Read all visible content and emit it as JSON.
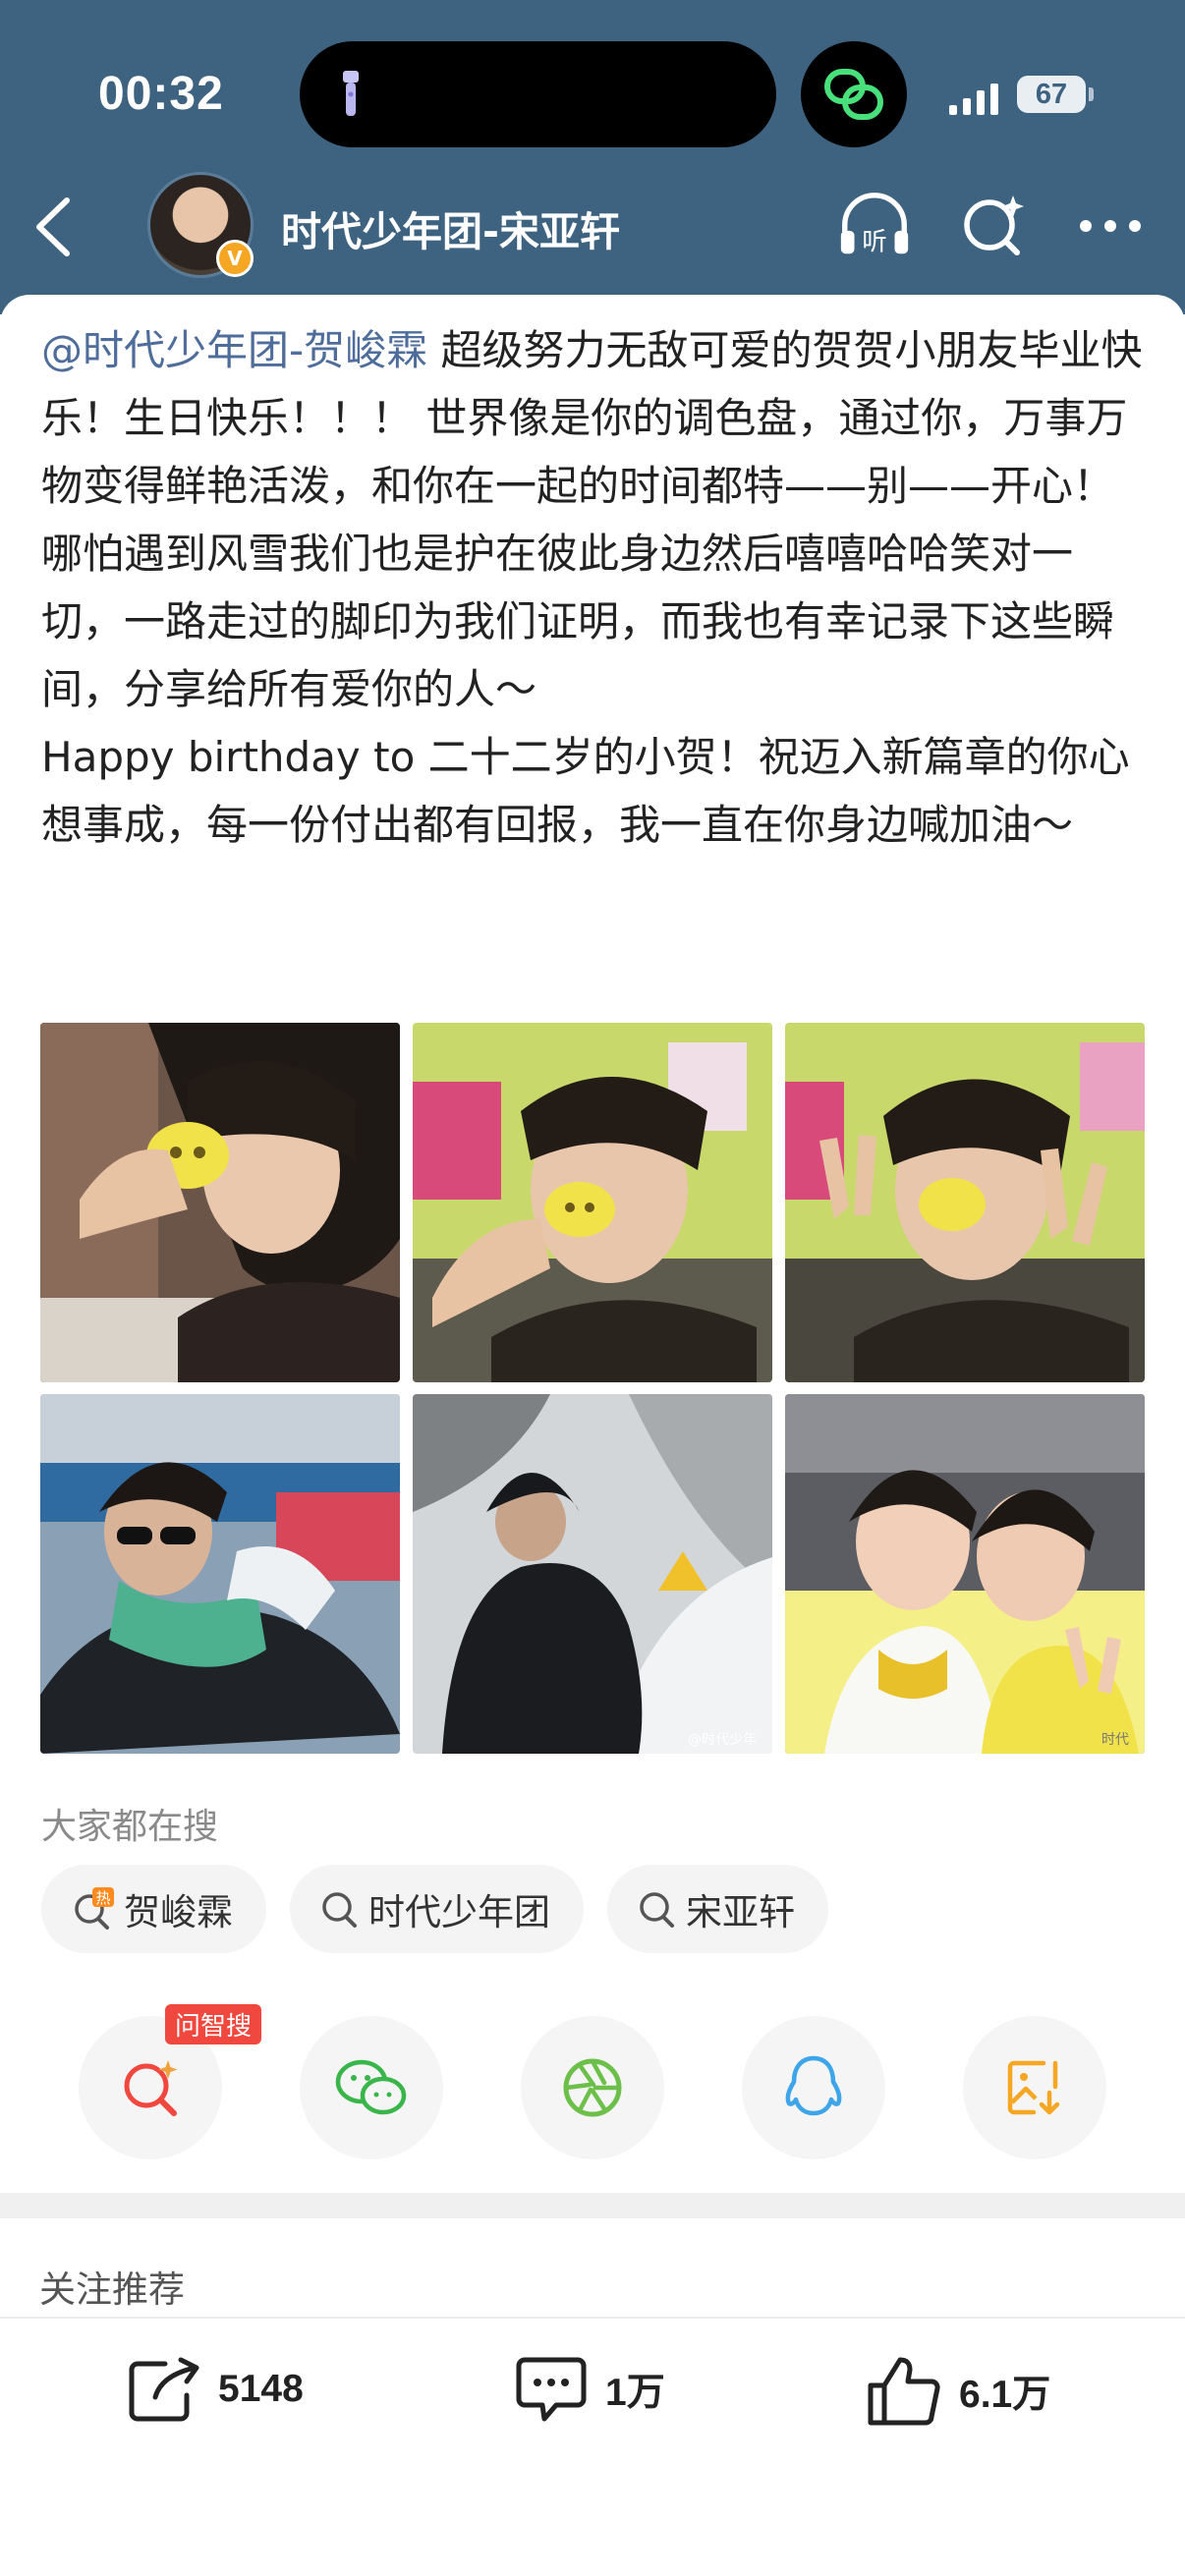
{
  "status_bar": {
    "time": "00:32",
    "battery": "67"
  },
  "nav": {
    "title": "时代少年团-宋亚轩",
    "verified_badge": "V"
  },
  "post": {
    "mention": "@时代少年团-贺峻霖",
    "paragraph1_rest": " 超级努力无敌可爱的贺贺小朋友毕业快乐！生日快乐！！！ 世界像是你的调色盘，通过你，万事万物变得鲜艳活泼，和你在一起的时间都特——别——开心！哪怕遇到风雪我们也是护在彼此身边然后嘻嘻哈哈笑对一切，一路走过的脚印为我们证明，而我也有幸记录下这些瞬间，分享给所有爱你的人～",
    "paragraph2": "Happy birthday to 二十二岁的小贺！祝迈入新篇章的你心想事成，每一份付出都有回报，我一直在你身边喊加油～"
  },
  "photos": {
    "photo5_watermark": "@时代少年",
    "photo6_watermark": "时代"
  },
  "hot_search": {
    "label": "大家都在搜",
    "hot_mark": "热",
    "chips": [
      "贺峻霖",
      "时代少年团",
      "宋亚轩"
    ]
  },
  "share": {
    "ai_badge": "问智搜"
  },
  "recommend_label": "关注推荐",
  "actions": {
    "reposts": "5148",
    "comments": "1万",
    "likes": "6.1万"
  },
  "colors": {
    "header_bg": "#3e6380",
    "mention": "#4f6d9a",
    "ai_badge": "#f0483e"
  }
}
